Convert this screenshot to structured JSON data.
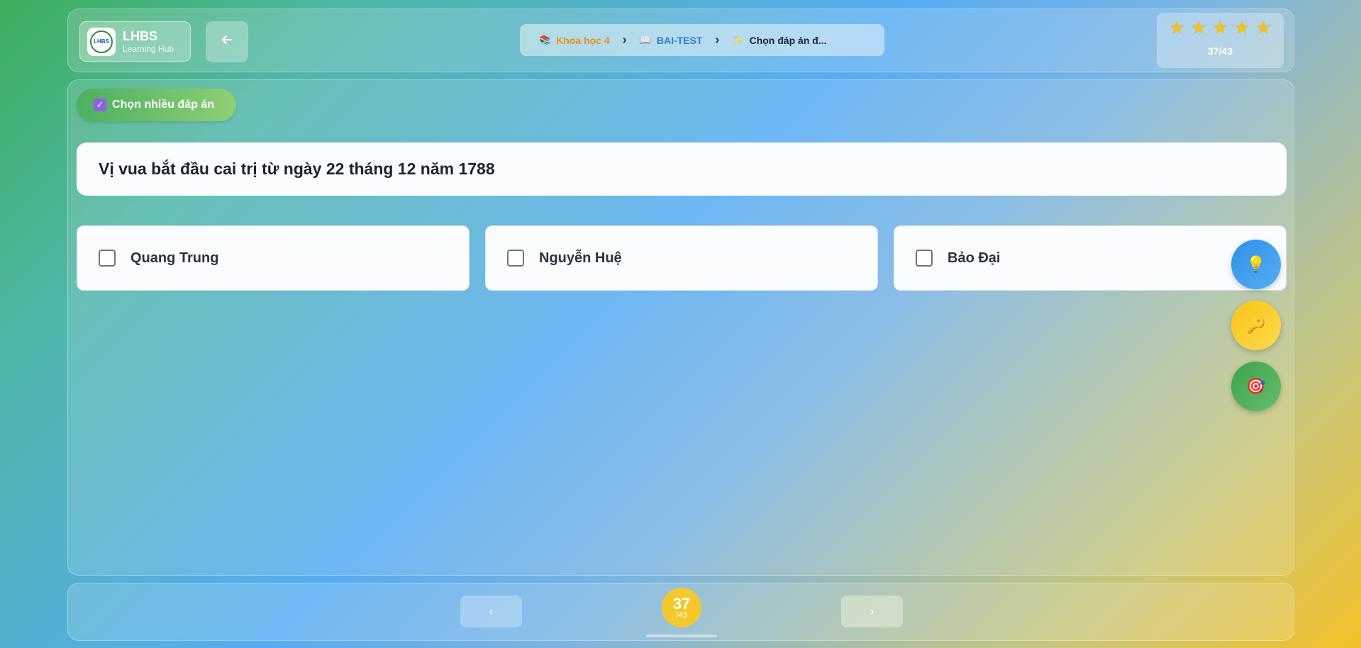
{
  "header": {
    "logo": {
      "title": "LHBS",
      "subtitle": "Learning Hub",
      "badge_text": "LHBS"
    },
    "back_icon": "arrow-left-icon",
    "breadcrumb": [
      {
        "icon": "books-icon",
        "label": "Khoa học 4"
      },
      {
        "icon": "open-book-icon",
        "label": "BAI-TEST"
      },
      {
        "icon": "sparkles-icon",
        "label": "Chọn đáp án đ..."
      }
    ],
    "stars_count": 5,
    "progress": "37/43"
  },
  "main": {
    "mode_label": "Chọn nhiều đáp án",
    "question": "Vị vua bắt đầu cai trị từ ngày 22 tháng 12 năm 1788",
    "options": [
      "Quang Trung",
      "Nguyễn Huệ",
      "Bảo Đại"
    ],
    "fabs": [
      {
        "name": "hint-button",
        "icon": "lightbulb-icon",
        "color": "#3a97ee"
      },
      {
        "name": "answer-key-button",
        "icon": "key-icon",
        "color": "#f9cc1f"
      },
      {
        "name": "target-button",
        "icon": "target-icon",
        "color": "#4aab56"
      }
    ]
  },
  "footer": {
    "prev_icon": "chevron-left-icon",
    "next_icon": "chevron-right-icon",
    "current": "37",
    "total": "/43"
  }
}
